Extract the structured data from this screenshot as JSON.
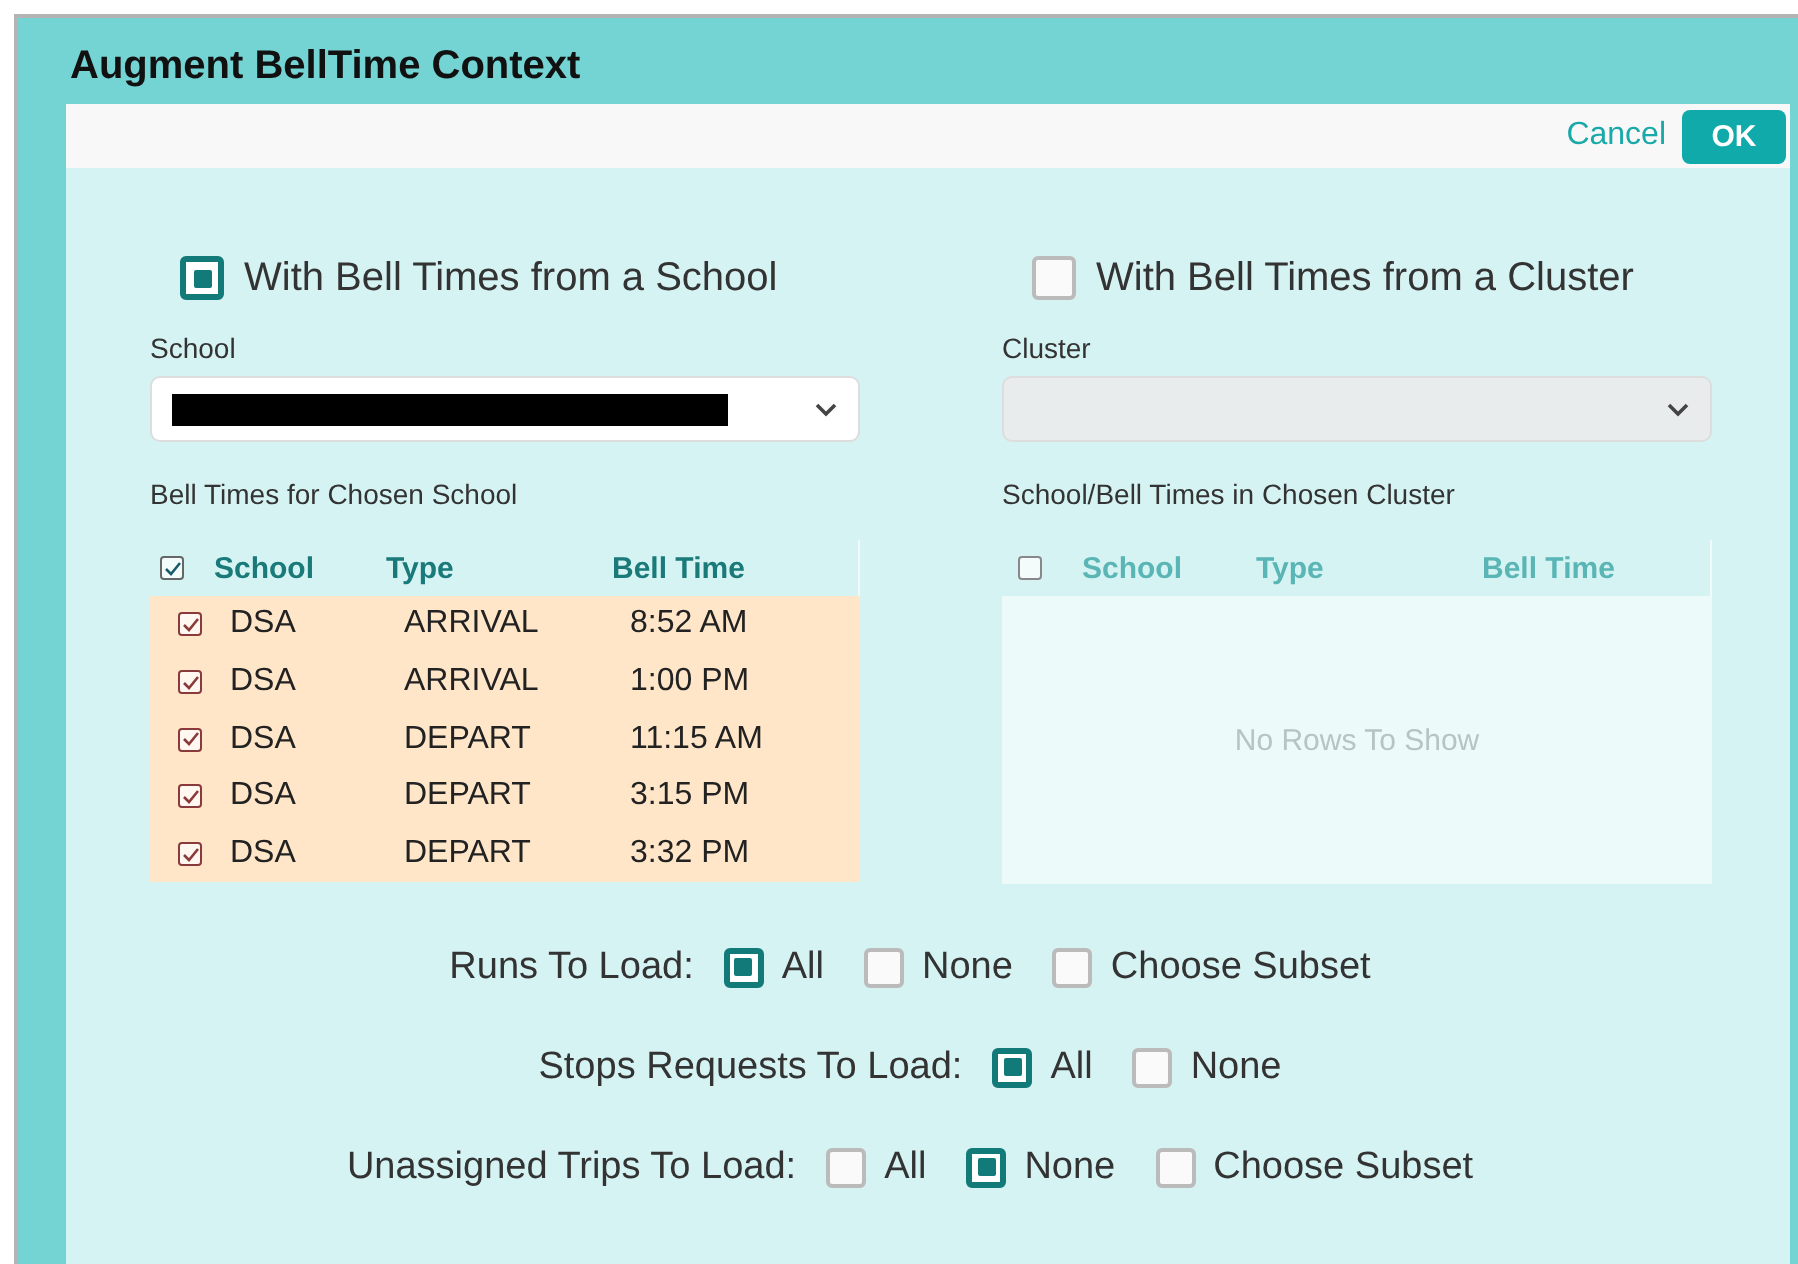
{
  "dialog": {
    "title": "Augment BellTime Context"
  },
  "actions": {
    "cancel": "Cancel",
    "ok": "OK"
  },
  "sources": [
    {
      "label": "With Bell Times from a School",
      "selected": true,
      "field_label": "School",
      "field_disabled": false,
      "field_redacted": true,
      "table_label": "Bell Times for Chosen School",
      "table_disabled": false,
      "columns": [
        "School",
        "Type",
        "Bell Time"
      ],
      "all_checked": true,
      "rows": [
        {
          "checked": true,
          "school": "DSA",
          "type": "ARRIVAL",
          "bell_time": "8:52 AM"
        },
        {
          "checked": true,
          "school": "DSA",
          "type": "ARRIVAL",
          "bell_time": "1:00 PM"
        },
        {
          "checked": true,
          "school": "DSA",
          "type": "DEPART",
          "bell_time": "11:15 AM"
        },
        {
          "checked": true,
          "school": "DSA",
          "type": "DEPART",
          "bell_time": "3:15 PM"
        },
        {
          "checked": true,
          "school": "DSA",
          "type": "DEPART",
          "bell_time": "3:32 PM"
        }
      ]
    },
    {
      "label": "With Bell Times from a Cluster",
      "selected": false,
      "field_label": "Cluster",
      "field_disabled": true,
      "field_redacted": false,
      "table_label": "School/Bell Times in Chosen Cluster",
      "table_disabled": true,
      "columns": [
        "School",
        "Type",
        "Bell Time"
      ],
      "all_checked": false,
      "empty_message": "No Rows To Show"
    }
  ],
  "load_options": [
    {
      "label": "Runs To Load:",
      "options": [
        {
          "label": "All",
          "selected": true
        },
        {
          "label": "None",
          "selected": false
        },
        {
          "label": "Choose Subset",
          "selected": false
        }
      ]
    },
    {
      "label": "Stops Requests To Load:",
      "options": [
        {
          "label": "All",
          "selected": true
        },
        {
          "label": "None",
          "selected": false
        }
      ]
    },
    {
      "label": "Unassigned Trips To Load:",
      "options": [
        {
          "label": "All",
          "selected": false
        },
        {
          "label": "None",
          "selected": true
        },
        {
          "label": "Choose Subset",
          "selected": false
        }
      ]
    }
  ]
}
